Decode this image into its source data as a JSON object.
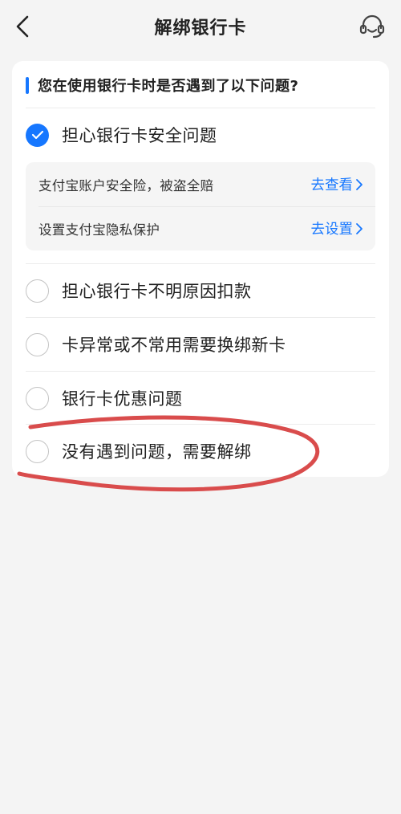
{
  "header": {
    "title": "解绑银行卡",
    "back_icon": "chevron-left-icon",
    "service_icon": "customer-service-headset-icon"
  },
  "question": {
    "text": "您在使用银行卡时是否遇到了以下问题?"
  },
  "options": [
    {
      "label": "担心银行卡安全问题",
      "checked": true
    },
    {
      "label": "担心银行卡不明原因扣款",
      "checked": false
    },
    {
      "label": "卡异常或不常用需要换绑新卡",
      "checked": false
    },
    {
      "label": "银行卡优惠问题",
      "checked": false
    },
    {
      "label": "没有遇到问题，需要解绑",
      "checked": false
    }
  ],
  "sub_items": [
    {
      "label": "支付宝账户安全险，被盗全赔",
      "link": "去查看"
    },
    {
      "label": "设置支付宝隐私保护",
      "link": "去设置"
    }
  ],
  "colors": {
    "accent": "#1677ff",
    "background": "#f4f4f4",
    "card": "#ffffff",
    "annotation_stroke": "#d94c4c"
  }
}
